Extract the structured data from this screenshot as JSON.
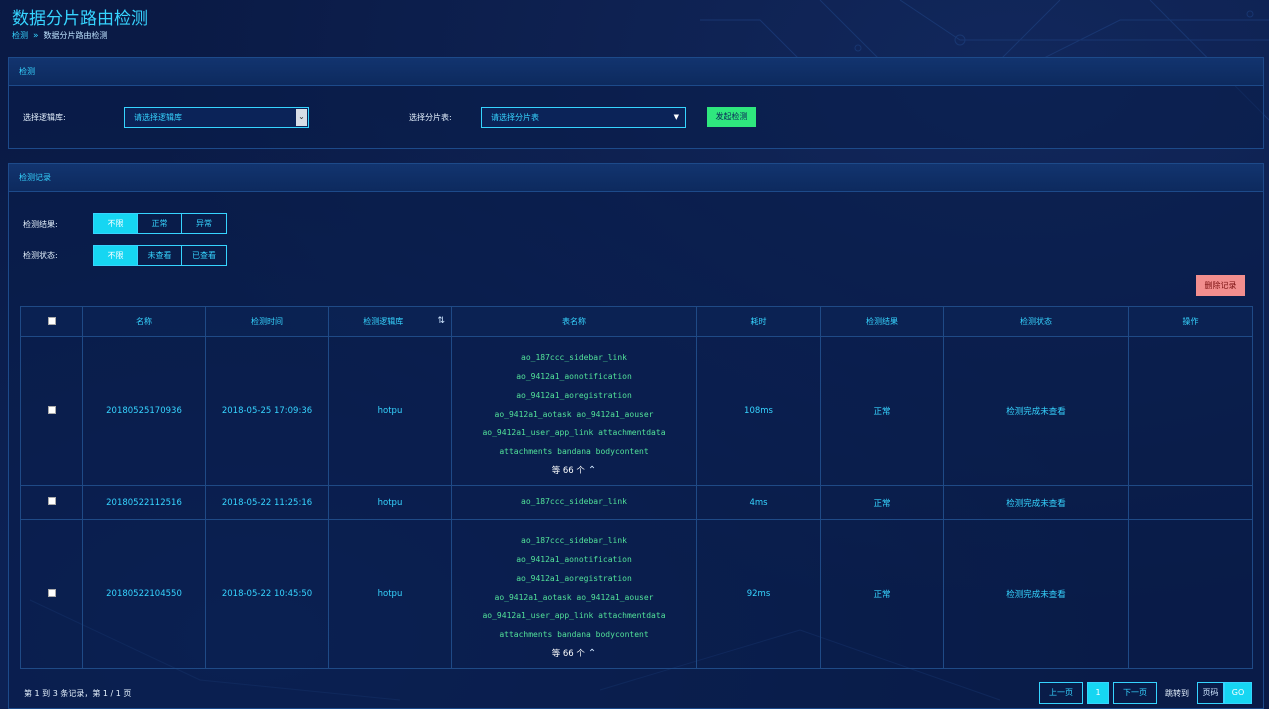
{
  "header": {
    "title": "数据分片路由检测",
    "breadcrumb": {
      "home": "检测",
      "sep": "»",
      "current": "数据分片路由检测"
    }
  },
  "detect_panel": {
    "title": "检测",
    "logic_db_label": "选择逻辑库:",
    "logic_db_placeholder": "请选择逻辑库",
    "shard_table_label": "选择分片表:",
    "shard_table_placeholder": "请选择分片表",
    "start_button": "发起检测"
  },
  "records_panel": {
    "title": "检测记录",
    "result_filter": {
      "label": "检测结果:",
      "options": [
        "不限",
        "正常",
        "异常"
      ],
      "active": "不限"
    },
    "status_filter": {
      "label": "检测状态:",
      "options": [
        "不限",
        "未查看",
        "已查看"
      ],
      "active": "不限"
    },
    "delete_button": "删除记录",
    "columns": [
      "名称",
      "检测时间",
      "检测逻辑库",
      "表名称",
      "耗时",
      "检测结果",
      "检测状态",
      "操作"
    ],
    "rows": [
      {
        "name": "20180525170936",
        "time": "2018-05-25 17:09:36",
        "db": "hotpu",
        "tables": [
          "ao_187ccc_sidebar_link",
          "ao_9412a1_aonotification",
          "ao_9412a1_aoregistration",
          "ao_9412a1_aotask  ao_9412a1_aouser",
          "ao_9412a1_user_app_link  attachmentdata",
          "attachments  bandana  bodycontent"
        ],
        "more": "等 66 个",
        "duration": "108ms",
        "result": "正常",
        "status": "检测完成未查看"
      },
      {
        "name": "20180522112516",
        "time": "2018-05-22 11:25:16",
        "db": "hotpu",
        "tables": [
          "ao_187ccc_sidebar_link"
        ],
        "more": "",
        "duration": "4ms",
        "result": "正常",
        "status": "检测完成未查看"
      },
      {
        "name": "20180522104550",
        "time": "2018-05-22 10:45:50",
        "db": "hotpu",
        "tables": [
          "ao_187ccc_sidebar_link",
          "ao_9412a1_aonotification",
          "ao_9412a1_aoregistration",
          "ao_9412a1_aotask  ao_9412a1_aouser",
          "ao_9412a1_user_app_link  attachmentdata",
          "attachments  bandana  bodycontent"
        ],
        "more": "等 66 个",
        "duration": "92ms",
        "result": "正常",
        "status": "检测完成未查看"
      }
    ],
    "footer": {
      "summary": "第 1 到 3 条记录，第 1 / 1 页",
      "prev": "上一页",
      "page": "1",
      "next": "下一页",
      "jump_label": "跳转到",
      "page_input_placeholder": "页码",
      "go": "GO"
    }
  },
  "colors": {
    "accent": "#36d4ff",
    "green": "#2fe77e",
    "danger": "#f28e8e",
    "bg": "#0a1a45"
  }
}
